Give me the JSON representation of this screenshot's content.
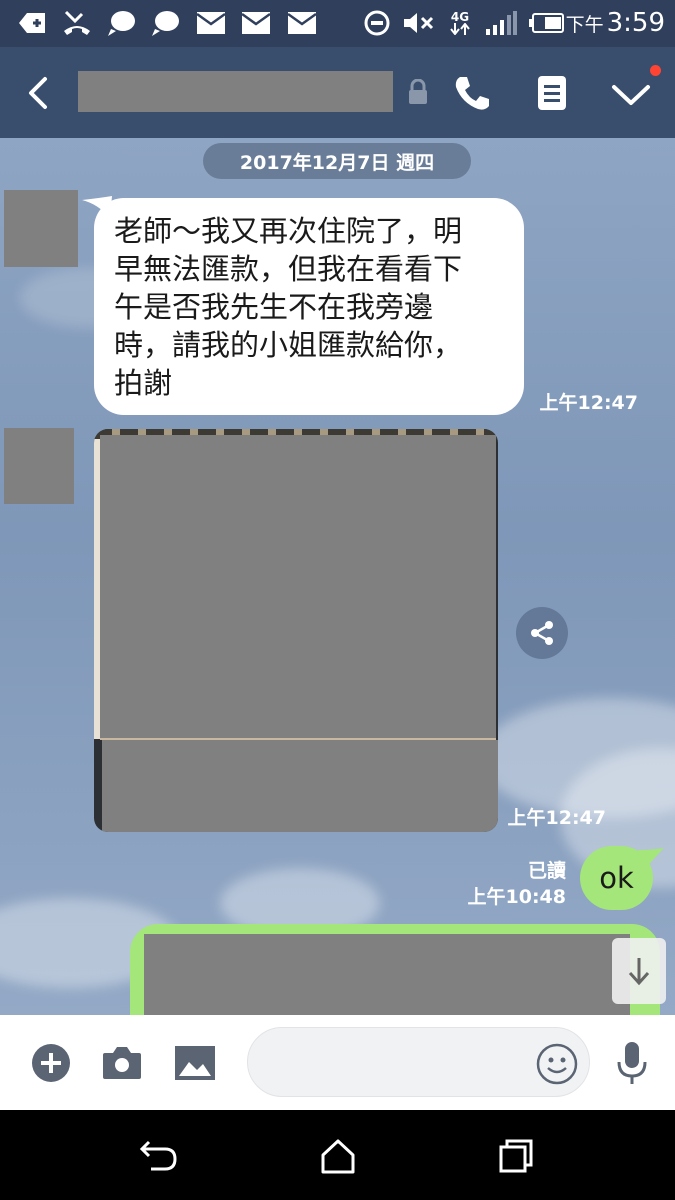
{
  "status_bar": {
    "left_icons": [
      "add-notification-icon",
      "missed-call-icon",
      "chat-bubble-icon",
      "chat-bubble-icon",
      "mail-icon",
      "mail-icon",
      "mail-icon"
    ],
    "right_icons": [
      "do-not-disturb-icon",
      "mute-icon",
      "4g-icon",
      "signal-icon",
      "battery-icon"
    ],
    "network": "4G",
    "ampm": "下午",
    "time": "3:59"
  },
  "header": {
    "chat_name_redacted": true,
    "icons": [
      "back-icon",
      "lock-icon",
      "phone-icon",
      "menu-icon",
      "chevron-down-icon"
    ],
    "notification_dot_color": "#ff4433"
  },
  "chat": {
    "date_divider": "2017年12月7日 週四",
    "messages": [
      {
        "direction": "incoming",
        "type": "text",
        "lines": [
          "老師～我又再次住院了，明",
          "早無法匯款，但我在看看下",
          "午是否我先生不在我旁邊",
          "時，請我的小姐匯款給你，",
          "拍謝"
        ],
        "time": "上午12:47"
      },
      {
        "direction": "incoming",
        "type": "image",
        "time": "上午12:47"
      },
      {
        "direction": "outgoing",
        "type": "text",
        "text": "ok",
        "read_label": "已讀",
        "time": "上午10:48"
      },
      {
        "direction": "outgoing",
        "type": "redacted"
      }
    ]
  },
  "input_bar": {
    "placeholder": "",
    "icons": [
      "plus-icon",
      "camera-icon",
      "image-icon",
      "emoji-icon",
      "microphone-icon"
    ]
  },
  "nav_bar": {
    "icons": [
      "back-nav-icon",
      "home-icon",
      "recents-icon"
    ]
  },
  "colors": {
    "status_bar": "#2f3f5c",
    "header": "#394e6c",
    "outgoing_bubble": "#a4e67a",
    "incoming_bubble": "#ffffff",
    "redaction": "#808080"
  }
}
